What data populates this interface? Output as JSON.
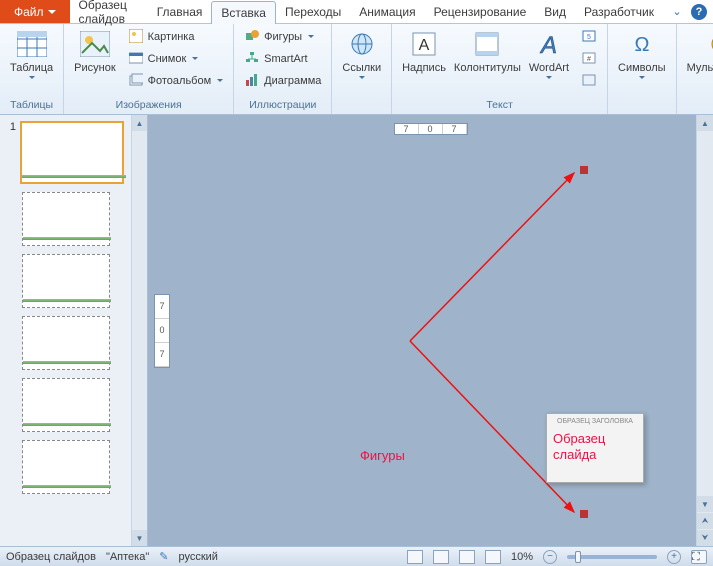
{
  "tabs": {
    "file": "Файл",
    "list": [
      "Образец слайдов",
      "Главная",
      "Вставка",
      "Переходы",
      "Анимация",
      "Рецензирование",
      "Вид",
      "Разработчик"
    ],
    "active_index": 2
  },
  "ribbon": {
    "groups": {
      "tables": {
        "label": "Таблицы",
        "table_btn": "Таблица"
      },
      "images": {
        "label": "Изображения",
        "picture_btn": "Рисунок",
        "clipart": "Картинка",
        "screenshot": "Снимок",
        "photoalbum": "Фотоальбом"
      },
      "illustrations": {
        "label": "Иллюстрации",
        "shapes": "Фигуры",
        "smartart": "SmartArt",
        "chart": "Диаграмма"
      },
      "links": {
        "label": "",
        "links_btn": "Ссылки"
      },
      "text": {
        "label": "Текст",
        "textbox": "Надпись",
        "headerfooter": "Колонтитулы",
        "wordart": "WordArt"
      },
      "symbols": {
        "label": "",
        "symbols_btn": "Символы"
      },
      "media": {
        "label": "",
        "media_btn": "Мультимедиа"
      }
    }
  },
  "thumbs": {
    "master_num": "1"
  },
  "editor": {
    "ruler_h": [
      "7",
      "0",
      "7"
    ],
    "ruler_v": [
      "7",
      "0",
      "7"
    ],
    "annotation": "Фигуры",
    "sample_header": "ОБРАЗЕЦ ЗАГОЛОВКА",
    "sample_title": "Образец слайда"
  },
  "status": {
    "mode": "Образец слайдов",
    "theme": "\"Аптека\"",
    "language": "русский",
    "zoom": "10%"
  }
}
